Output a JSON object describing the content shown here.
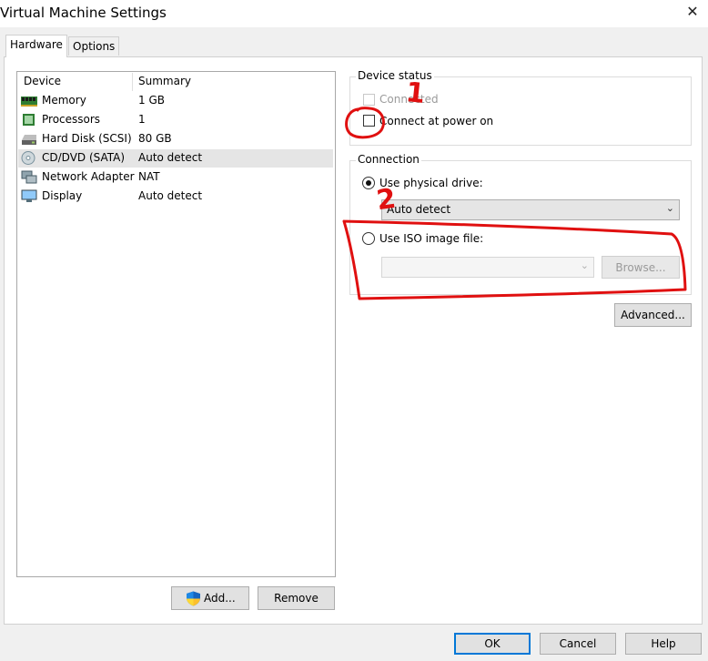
{
  "window": {
    "title": "Virtual Machine Settings",
    "close_glyph": "✕"
  },
  "tabs": [
    {
      "label": "Hardware",
      "active": true
    },
    {
      "label": "Options",
      "active": false
    }
  ],
  "device_list": {
    "columns": [
      "Device",
      "Summary"
    ],
    "rows": [
      {
        "icon": "memory-icon",
        "name": "Memory",
        "summary": "1 GB",
        "selected": false
      },
      {
        "icon": "processor-icon",
        "name": "Processors",
        "summary": "1",
        "selected": false
      },
      {
        "icon": "hard-disk-icon",
        "name": "Hard Disk (SCSI)",
        "summary": "80 GB",
        "selected": false
      },
      {
        "icon": "cd-dvd-icon",
        "name": "CD/DVD (SATA)",
        "summary": "Auto detect",
        "selected": true
      },
      {
        "icon": "network-adapter-icon",
        "name": "Network Adapter",
        "summary": "NAT",
        "selected": false
      },
      {
        "icon": "display-icon",
        "name": "Display",
        "summary": "Auto detect",
        "selected": false
      }
    ]
  },
  "buttons": {
    "add": "Add...",
    "remove": "Remove",
    "ok": "OK",
    "cancel": "Cancel",
    "help": "Help"
  },
  "device_status": {
    "label": "Device status",
    "connected": {
      "label": "Connected",
      "checked": false,
      "enabled": false
    },
    "connect_at_power_on": {
      "label": "Connect at power on",
      "checked": false,
      "enabled": true
    }
  },
  "connection": {
    "label": "Connection",
    "physical": {
      "label": "Use physical drive:",
      "selected": true,
      "value": "Auto detect"
    },
    "iso": {
      "label": "Use ISO image file:",
      "selected": false,
      "value": "",
      "browse": "Browse..."
    }
  },
  "advanced_button": "Advanced...",
  "annotations": {
    "mark_1": "1",
    "mark_2": "2",
    "color": "#e01010"
  }
}
